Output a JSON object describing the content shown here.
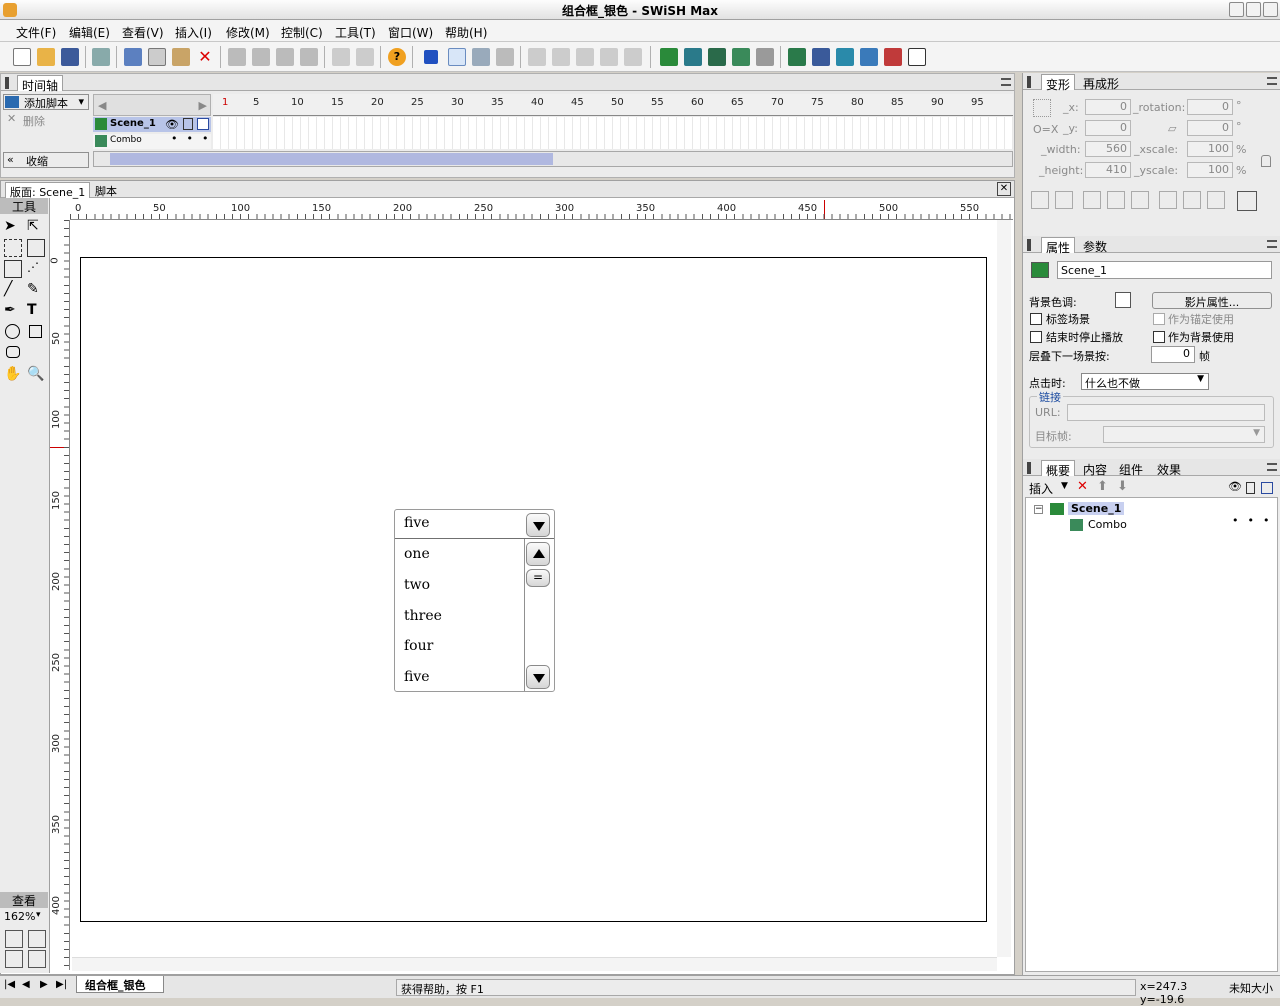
{
  "window": {
    "title": "组合框_银色 - SWiSH Max"
  },
  "menubar": [
    "文件(F)",
    "编辑(E)",
    "查看(V)",
    "插入(I)",
    "修改(M)",
    "控制(C)",
    "工具(T)",
    "窗口(W)",
    "帮助(H)"
  ],
  "timeline": {
    "tab": "时间轴",
    "add_script": "添加脚本",
    "delete": "删除",
    "collapse": "收缩",
    "layers": [
      "Scene_1",
      "Combo"
    ],
    "ruler_labels": [
      "1",
      "5",
      "10",
      "15",
      "20",
      "25",
      "30",
      "35",
      "40",
      "45",
      "50",
      "55",
      "60",
      "65",
      "70",
      "75",
      "80",
      "85",
      "90",
      "95"
    ]
  },
  "stage": {
    "tabs": [
      "版面: Scene_1",
      "脚本"
    ],
    "tools_label": "工具",
    "view_label": "查看",
    "zoom": "162%",
    "hruler": [
      "0",
      "50",
      "100",
      "150",
      "200",
      "250",
      "300",
      "350",
      "400",
      "450",
      "500",
      "550"
    ],
    "vruler": [
      "0",
      "50",
      "100",
      "150",
      "200",
      "250",
      "300",
      "350",
      "400"
    ],
    "combo": {
      "selected": "five",
      "items": [
        "one",
        "two",
        "three",
        "four",
        "five"
      ]
    }
  },
  "transform": {
    "tabs": [
      "变形",
      "再成形"
    ],
    "x_label": "_x:",
    "x": "0",
    "y_label": "_y:",
    "y": "0",
    "rotation_label": "_rotation:",
    "rotation": "0",
    "skew": "0",
    "width_label": "_width:",
    "width": "560",
    "height_label": "_height:",
    "height": "410",
    "xscale_label": "_xscale:",
    "xscale": "100",
    "yscale_label": "_yscale:",
    "yscale": "100",
    "deg": "°",
    "pct": "%",
    "origin_label": "O=X"
  },
  "properties": {
    "tabs": [
      "属性",
      "参数"
    ],
    "name": "Scene_1",
    "bg_color_label": "背景色调:",
    "movie_props_btn": "影片属性...",
    "label_scene": "标签场景",
    "anchor_use": "作为锚定使用",
    "stop_at_end": "结束时停止播放",
    "use_as_bg": "作为背景使用",
    "overlay_label": "层叠下一场景按:",
    "overlay_value": "0",
    "frames_unit": "帧",
    "on_click_label": "点击时:",
    "on_click_value": "什么也不做",
    "link_group": "链接",
    "url_label": "URL:",
    "target_label": "目标帧:"
  },
  "outline": {
    "tabs": [
      "概要",
      "内容",
      "组件",
      "效果"
    ],
    "insert": "插入",
    "tree": [
      "Scene_1",
      "Combo"
    ]
  },
  "status": {
    "file_tab": "组合框_银色",
    "help": "获得帮助，按 F1",
    "coords": "x=247.3 y=-19.6",
    "size": "未知大小"
  }
}
